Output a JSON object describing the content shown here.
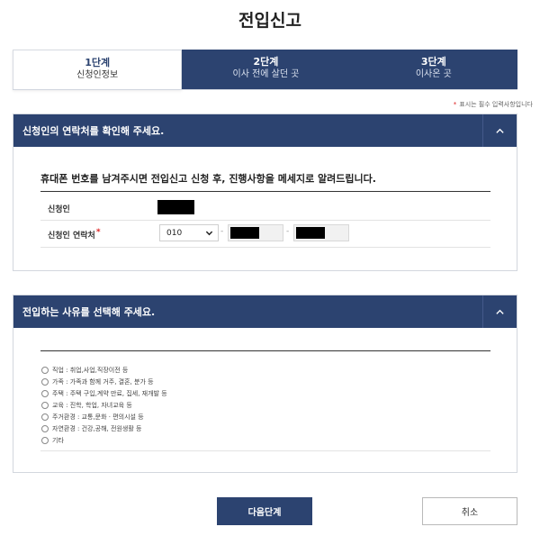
{
  "page": {
    "title": "전입신고"
  },
  "steps": [
    {
      "num": "1단계",
      "label": "신청인정보",
      "active": true
    },
    {
      "num": "2단계",
      "label": "이사 전에 살던 곳",
      "active": false
    },
    {
      "num": "3단계",
      "label": "이사온 곳",
      "active": false
    }
  ],
  "required_note": {
    "star": "*",
    "text": "표시는 필수 입력사항입니다"
  },
  "applicant_panel": {
    "title": "신청인의 연락처를 확인해 주세요.",
    "notice": "휴대폰 번호를 남겨주시면 전입신고 신청 후, 진행사항을 메세지로 알려드립니다.",
    "name_label": "신청인",
    "phone_label": "신청인 연락처",
    "phone_required_star": "*",
    "phone_prefix": "010",
    "phone_separator": "-"
  },
  "reason_panel": {
    "title": "전입하는 사유를 선택해 주세요.",
    "options": [
      "직업 : 취업,사업,직장이전 등",
      "가족 : 가족과 함께 거주, 결혼, 분가 등",
      "주택 : 주택 구입,계약 만료, 집세, 재개발 등",
      "교육 : 진학, 학업, 자녀교육 등",
      "주거환경 : 교통,문화 · 편의시설 등",
      "자연환경 : 건강,공해, 전원생활 등",
      "기타"
    ]
  },
  "buttons": {
    "next": "다음단계",
    "cancel": "취소"
  },
  "colors": {
    "primary": "#2c4370",
    "required": "#dd2222"
  },
  "icons": {
    "panel_toggle": "chevron-up-icon",
    "select": "chevron-down-icon",
    "radio": "radio-icon"
  }
}
